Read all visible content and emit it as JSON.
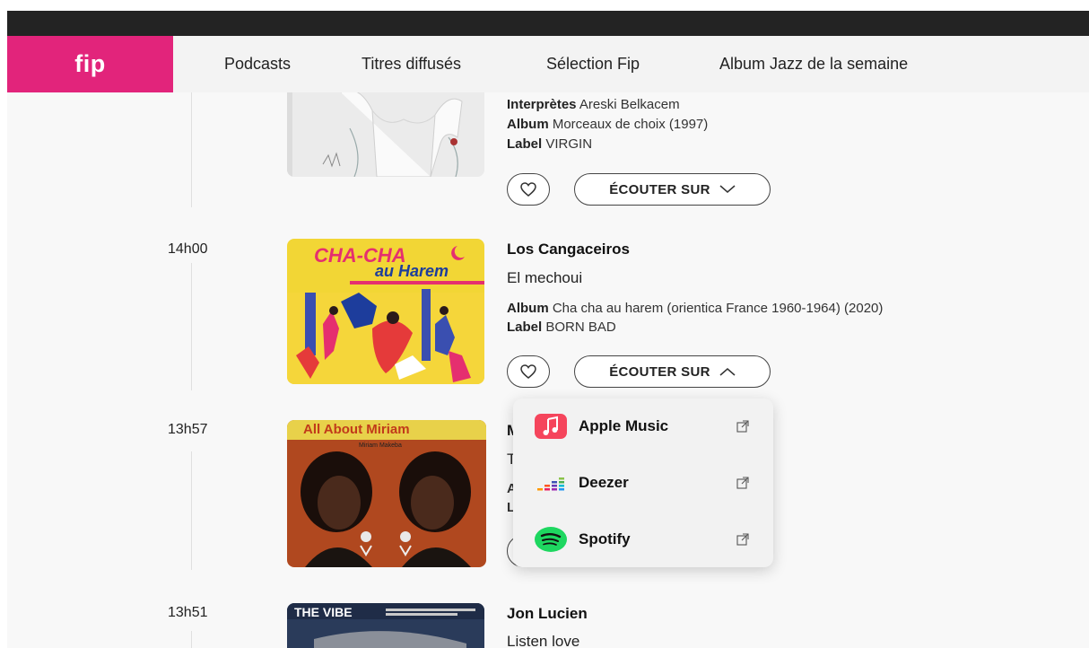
{
  "nav": {
    "logo": "fip",
    "links": [
      "Podcasts",
      "Titres diffusés",
      "Sélection Fip",
      "Album Jazz de la semaine"
    ]
  },
  "tracks": [
    {
      "time": "",
      "artist": "",
      "title": "",
      "performers_label": "Interprètes",
      "performers": "Areski Belkacem",
      "album_label": "Album",
      "album": "Morceaux de choix (1997)",
      "label_label": "Label",
      "label": "VIRGIN",
      "listen_label": "ÉCOUTER SUR"
    },
    {
      "time": "14h00",
      "artist": "Los Cangaceiros",
      "title": "El mechoui",
      "album_label": "Album",
      "album": "Cha cha au harem (orientica France 1960-1964) (2020)",
      "label_label": "Label",
      "label": "BORN BAD",
      "listen_label": "ÉCOUTER SUR",
      "cover_text_1": "CHA-CHA",
      "cover_text_2": "au Harem"
    },
    {
      "time": "13h57",
      "artist_initial": "M",
      "title_initial": "T",
      "meta_initial_1": "A",
      "meta_initial_2": "L",
      "cover_text_1": "All About Miriam",
      "cover_text_2": "Miriam Makeba"
    },
    {
      "time": "13h51",
      "artist": "Jon Lucien",
      "title": "Listen love",
      "cover_text_1": "THE VIBE"
    }
  ],
  "dropdown": {
    "items": [
      {
        "label": "Apple Music",
        "icon": "apple-music-icon",
        "color": "#f5455c"
      },
      {
        "label": "Deezer",
        "icon": "deezer-icon",
        "color": "#a238ff"
      },
      {
        "label": "Spotify",
        "icon": "spotify-icon",
        "color": "#1ed760"
      }
    ]
  },
  "colors": {
    "brand": "#e2247b",
    "nav_bg": "#f3f3f3",
    "dark_bar": "#232323"
  }
}
